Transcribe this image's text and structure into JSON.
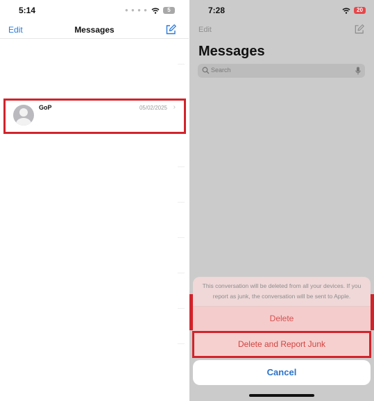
{
  "left_screen": {
    "status_bar": {
      "time": "5:14",
      "battery": "5"
    },
    "nav": {
      "edit_label": "Edit",
      "title": "Messages"
    },
    "conversation": {
      "sender": "GoP",
      "date": "05/02/2025"
    }
  },
  "right_screen": {
    "status_bar": {
      "time": "7:28",
      "battery": "20"
    },
    "nav": {
      "edit_label": "Edit",
      "large_title": "Messages"
    },
    "search": {
      "placeholder": "Search"
    },
    "action_sheet": {
      "message": "This conversation will be deleted from all your devices. If you report as junk, the conversation will be sent to Apple.",
      "delete_label": "Delete",
      "report_label": "Delete and Report Junk",
      "cancel_label": "Cancel"
    }
  },
  "colors": {
    "accent_blue": "#2a7ad8",
    "destructive_red": "#d8504e",
    "highlight_red": "#d2232a"
  },
  "icons": [
    "wifi-icon",
    "compose-icon",
    "chevron-right-icon",
    "search-icon",
    "microphone-icon",
    "avatar-placeholder-icon"
  ]
}
